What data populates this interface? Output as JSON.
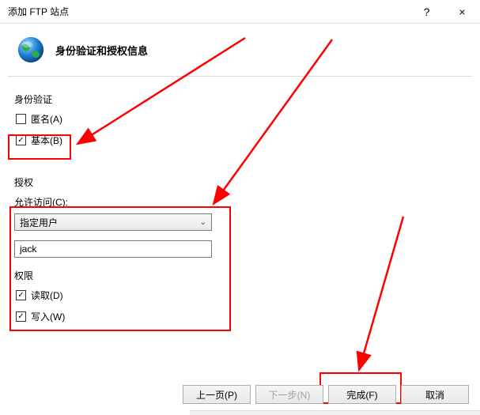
{
  "window": {
    "title": "添加 FTP 站点",
    "help": "?",
    "close": "×"
  },
  "header": {
    "title": "身份验证和授权信息"
  },
  "auth": {
    "section_label": "身份验证",
    "anonymous_label": "匿名(A)",
    "basic_label": "基本(B)"
  },
  "authorization": {
    "section_label": "授权",
    "allow_access_label": "允许访问(C):",
    "select_value": "指定用户",
    "user_value": "jack",
    "permissions_label": "权限",
    "read_label": "读取(D)",
    "write_label": "写入(W)"
  },
  "buttons": {
    "prev": "上一页(P)",
    "next": "下一步(N)",
    "finish": "完成(F)",
    "cancel": "取消"
  }
}
